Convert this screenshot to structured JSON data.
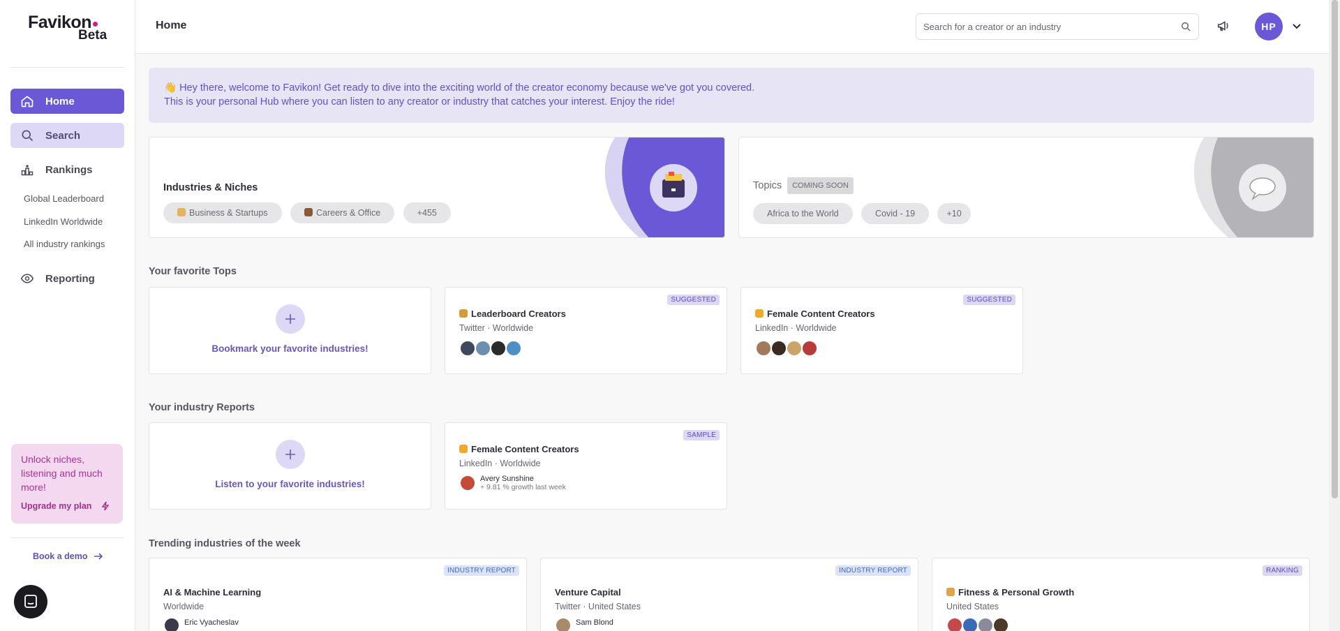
{
  "app": {
    "logo_text": "Favikon",
    "logo_sub": "Beta"
  },
  "sidebar": {
    "nav": [
      {
        "label": "Home",
        "icon": "home-icon"
      },
      {
        "label": "Search",
        "icon": "search-icon"
      },
      {
        "label": "Rankings",
        "icon": "rankings-icon"
      }
    ],
    "rankings_links": [
      "Global Leaderboard",
      "LinkedIn Worldwide",
      "All industry rankings"
    ],
    "reporting_label": "Reporting",
    "upgrade": {
      "text": "Unlock niches, listening and much more!",
      "button": "Upgrade my plan"
    },
    "book_demo": "Book a demo"
  },
  "header": {
    "title": "Home",
    "search_placeholder": "Search for a creator or an industry",
    "avatar_initials": "HP"
  },
  "welcome": {
    "line1": "👋 Hey there, welcome to Favikon! Get ready to dive into the exciting world of the creator economy because we've got you covered.",
    "line2": "This is your personal Hub where you can listen to any creator or industry that catches your interest. Enjoy the ride!"
  },
  "industries_card": {
    "title": "Industries & Niches",
    "pills": [
      "Business & Startups",
      "Careers & Office",
      "+455"
    ]
  },
  "topics_card": {
    "title": "Topics",
    "badge": "COMING SOON",
    "pills": [
      "Africa to the World",
      "Covid - 19",
      "+10"
    ]
  },
  "favorite_tops": {
    "section_title": "Your favorite Tops",
    "add_text": "Bookmark your favorite industries!",
    "cards": [
      {
        "badge": "SUGGESTED",
        "title": "Leaderboard Creators",
        "sub": "Twitter · Worldwide"
      },
      {
        "badge": "SUGGESTED",
        "title": "Female Content Creators",
        "sub": "LinkedIn · Worldwide"
      }
    ]
  },
  "industry_reports": {
    "section_title": "Your industry Reports",
    "add_text": "Listen to your favorite industries!",
    "sample": {
      "badge": "SAMPLE",
      "title": "Female Content Creators",
      "sub": "LinkedIn · Worldwide",
      "person_name": "Avery Sunshine",
      "person_growth": "+ 9.81 % growth last week"
    }
  },
  "trending": {
    "section_title": "Trending industries of the week",
    "cards": [
      {
        "badge": "INDUSTRY REPORT",
        "title": "AI & Machine Learning",
        "sub": "Worldwide",
        "person": "Eric Vyacheslav"
      },
      {
        "badge": "INDUSTRY REPORT",
        "title": "Venture Capital",
        "sub": "Twitter · United States",
        "person": "Sam Blond"
      },
      {
        "badge": "RANKING",
        "title": "Fitness & Personal Growth",
        "sub": "United States",
        "person": ""
      }
    ]
  },
  "colors": {
    "accent": "#6a58d6",
    "accent_light": "#e7e4f6",
    "upgrade_bg": "#f3d8f0"
  }
}
